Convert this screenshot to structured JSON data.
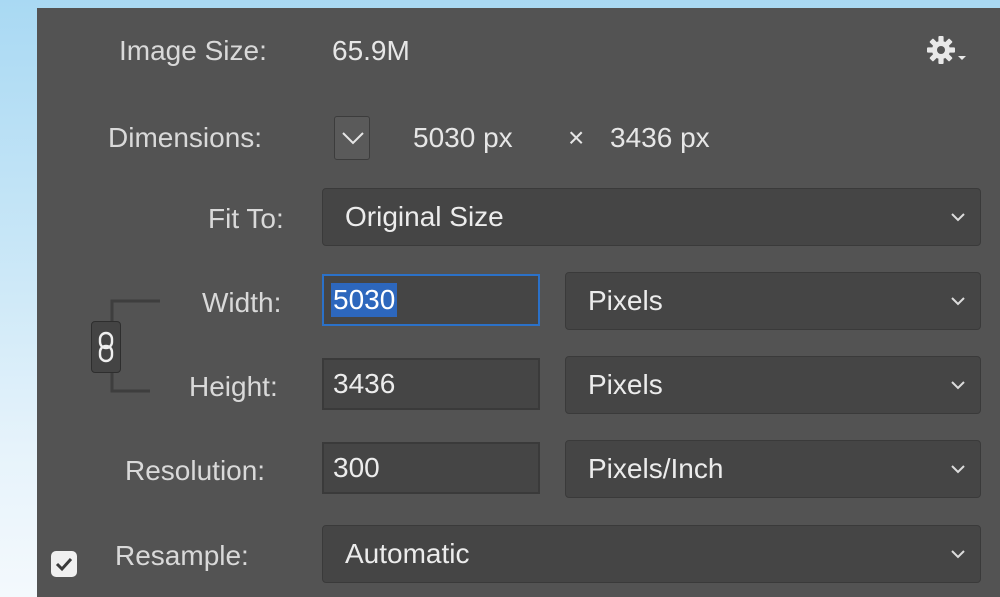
{
  "image_size": {
    "label": "Image Size:",
    "value": "65.9M"
  },
  "dimensions": {
    "label": "Dimensions:",
    "width": "5030 px",
    "times": "×",
    "height": "3436 px"
  },
  "fit_to": {
    "label": "Fit To:",
    "selected": "Original Size"
  },
  "width": {
    "label": "Width:",
    "value": "5030",
    "unit": "Pixels"
  },
  "height": {
    "label": "Height:",
    "value": "3436",
    "unit": "Pixels"
  },
  "resolution": {
    "label": "Resolution:",
    "value": "300",
    "unit": "Pixels/Inch"
  },
  "resample": {
    "label": "Resample:",
    "checked": true,
    "selected": "Automatic"
  },
  "icons": {
    "settings": "gear-icon",
    "dimensions_toggle": "chevron-down-icon",
    "constrain": "chain-link-icon",
    "select": "chevron-down-icon"
  },
  "colors": {
    "panel": "#535353",
    "focus": "#2b71c8",
    "selection": "#2d67bd"
  }
}
